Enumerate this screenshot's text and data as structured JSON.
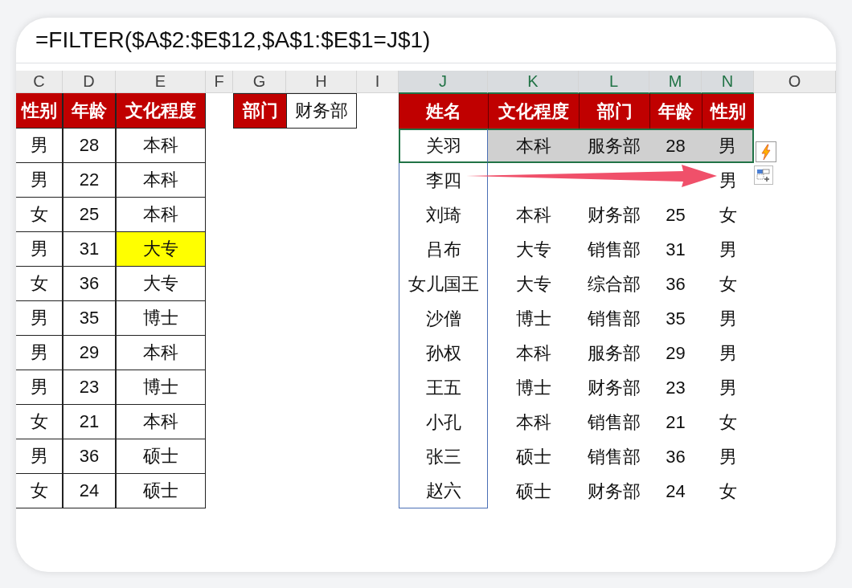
{
  "formula_bar": {
    "formula": "=FILTER($A$2:$E$12,$A$1:$E$1=J$1)"
  },
  "column_headers": [
    {
      "label": "C",
      "selected": false
    },
    {
      "label": "D",
      "selected": false
    },
    {
      "label": "E",
      "selected": false
    },
    {
      "label": "F",
      "selected": false
    },
    {
      "label": "G",
      "selected": false
    },
    {
      "label": "H",
      "selected": false
    },
    {
      "label": "I",
      "selected": false
    },
    {
      "label": "J",
      "selected": true
    },
    {
      "label": "K",
      "selected": true
    },
    {
      "label": "L",
      "selected": true
    },
    {
      "label": "M",
      "selected": true
    },
    {
      "label": "N",
      "selected": true
    },
    {
      "label": "O",
      "selected": false
    }
  ],
  "source_table": {
    "columns": [
      "性别",
      "年龄",
      "文化程度"
    ],
    "rows": [
      {
        "gender": "男",
        "age": "28",
        "education": "本科",
        "highlighted": false
      },
      {
        "gender": "男",
        "age": "22",
        "education": "本科",
        "highlighted": false
      },
      {
        "gender": "女",
        "age": "25",
        "education": "本科",
        "highlighted": false
      },
      {
        "gender": "男",
        "age": "31",
        "education": "大专",
        "highlighted": true
      },
      {
        "gender": "女",
        "age": "36",
        "education": "大专",
        "highlighted": false
      },
      {
        "gender": "男",
        "age": "35",
        "education": "博士",
        "highlighted": false
      },
      {
        "gender": "男",
        "age": "29",
        "education": "本科",
        "highlighted": false
      },
      {
        "gender": "男",
        "age": "23",
        "education": "博士",
        "highlighted": false
      },
      {
        "gender": "女",
        "age": "21",
        "education": "本科",
        "highlighted": false
      },
      {
        "gender": "男",
        "age": "36",
        "education": "硕士",
        "highlighted": false
      },
      {
        "gender": "女",
        "age": "24",
        "education": "硕士",
        "highlighted": false
      }
    ]
  },
  "criteria": {
    "label": "部门",
    "value": "财务部"
  },
  "result_table": {
    "columns": [
      "姓名",
      "文化程度",
      "部门",
      "年龄",
      "性别"
    ],
    "name_range_outlined": true,
    "rows": [
      {
        "cells": [
          "关羽",
          "本科",
          "服务部",
          "28",
          "男"
        ],
        "selected": true
      },
      {
        "cells": [
          "李四",
          null,
          null,
          null,
          "男"
        ],
        "selected": false
      },
      {
        "cells": [
          "刘琦",
          "本科",
          "财务部",
          "25",
          "女"
        ],
        "selected": false
      },
      {
        "cells": [
          "吕布",
          "大专",
          "销售部",
          "31",
          "男"
        ],
        "selected": false
      },
      {
        "cells": [
          "女儿国王",
          "大专",
          "综合部",
          "36",
          "女"
        ],
        "selected": false
      },
      {
        "cells": [
          "沙僧",
          "博士",
          "销售部",
          "35",
          "男"
        ],
        "selected": false
      },
      {
        "cells": [
          "孙权",
          "本科",
          "服务部",
          "29",
          "男"
        ],
        "selected": false
      },
      {
        "cells": [
          "王五",
          "博士",
          "财务部",
          "23",
          "男"
        ],
        "selected": false
      },
      {
        "cells": [
          "小孔",
          "本科",
          "销售部",
          "21",
          "女"
        ],
        "selected": false
      },
      {
        "cells": [
          "张三",
          "硕士",
          "销售部",
          "36",
          "男"
        ],
        "selected": false
      },
      {
        "cells": [
          "赵六",
          "硕士",
          "财务部",
          "24",
          "女"
        ],
        "selected": false
      }
    ]
  }
}
